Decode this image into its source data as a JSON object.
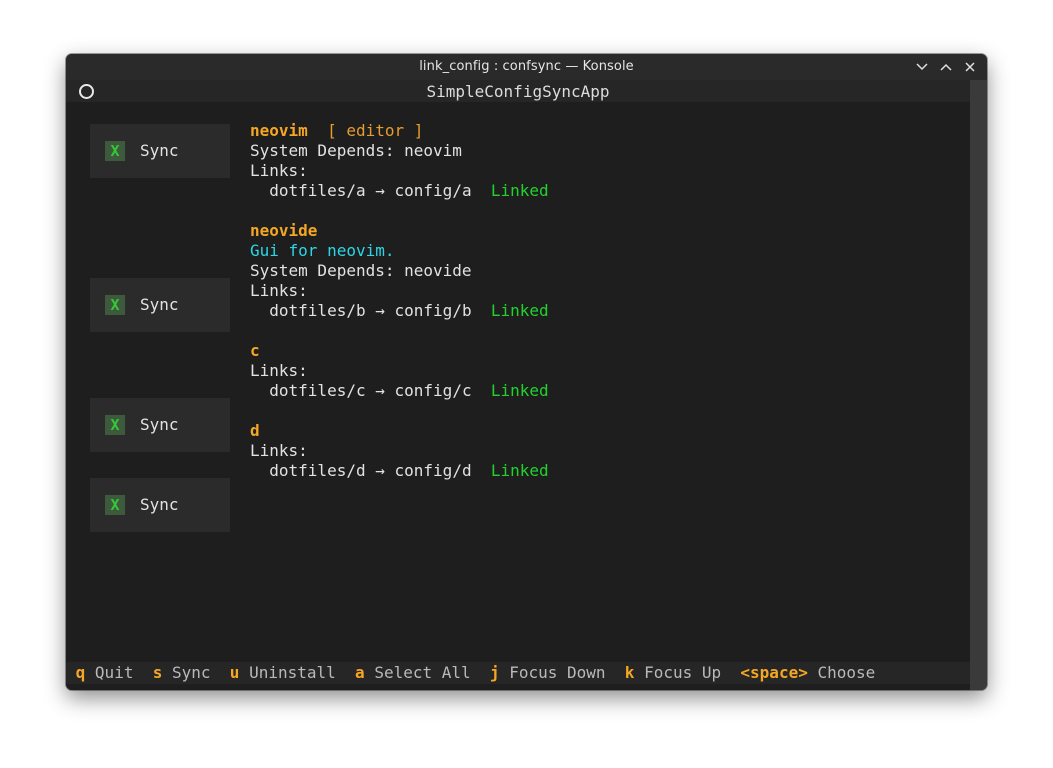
{
  "window": {
    "title": "link_config : confsync — Konsole",
    "controls": [
      "minimize",
      "maximize",
      "close"
    ]
  },
  "app": {
    "title": "SimpleConfigSyncApp"
  },
  "entries": [
    {
      "checkbox": "X",
      "sync_label": "Sync",
      "name": "neovim",
      "tag": "[ editor ]",
      "description": "",
      "depends": "System Depends: neovim",
      "links_label": "Links:",
      "link_from": "dotfiles/a",
      "arrow": "→",
      "link_to": "config/a",
      "status": "Linked"
    },
    {
      "checkbox": "X",
      "sync_label": "Sync",
      "name": "neovide",
      "tag": "",
      "description": "Gui for neovim.",
      "depends": "System Depends: neovide",
      "links_label": "Links:",
      "link_from": "dotfiles/b",
      "arrow": "→",
      "link_to": "config/b",
      "status": "Linked"
    },
    {
      "checkbox": "X",
      "sync_label": "Sync",
      "name": "c",
      "links_label": "Links:",
      "link_from": "dotfiles/c",
      "arrow": "→",
      "link_to": "config/c",
      "status": "Linked"
    },
    {
      "checkbox": "X",
      "sync_label": "Sync",
      "name": "d",
      "links_label": "Links:",
      "link_from": "dotfiles/d",
      "arrow": "→",
      "link_to": "config/d",
      "status": "Linked"
    }
  ],
  "footer": {
    "bindings": [
      {
        "key": "q",
        "action": "Quit"
      },
      {
        "key": "s",
        "action": "Sync"
      },
      {
        "key": "u",
        "action": "Uninstall"
      },
      {
        "key": "a",
        "action": "Select All"
      },
      {
        "key": "j",
        "action": "Focus Down"
      },
      {
        "key": "k",
        "action": "Focus Up"
      },
      {
        "key": "<space>",
        "action": "Choose"
      }
    ]
  },
  "colors": {
    "accent_orange": "#f5a623",
    "linked_green": "#22d22d",
    "description_cyan": "#2bd7e6",
    "background": "#1e1e1e"
  }
}
